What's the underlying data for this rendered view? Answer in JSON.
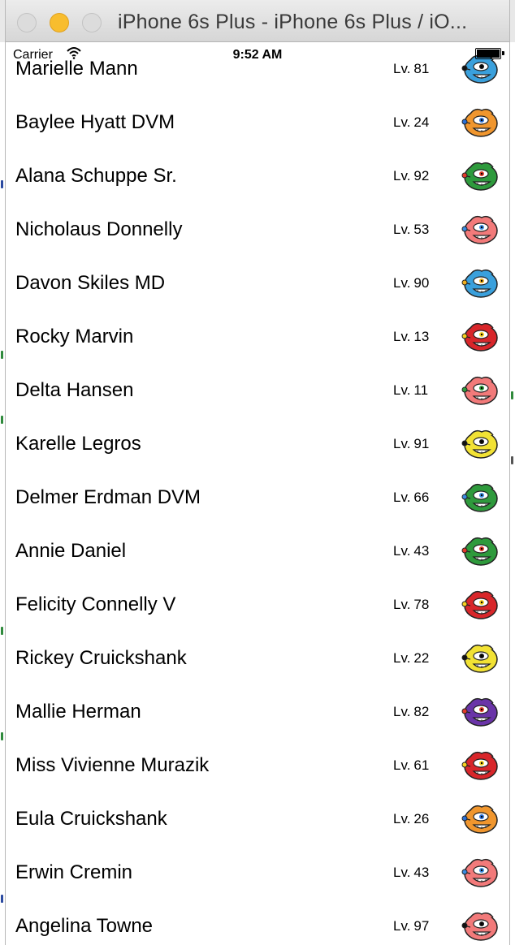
{
  "window": {
    "title": "iPhone 6s Plus - iPhone 6s Plus / iO..."
  },
  "status_bar": {
    "carrier": "Carrier",
    "time": "9:52 AM"
  },
  "level_prefix": "Lv.",
  "players": [
    {
      "name": "Marielle Mann",
      "level": "81",
      "avatar_color": "#3aa0dc",
      "eye_color": "#111111"
    },
    {
      "name": "Baylee Hyatt DVM",
      "level": "24",
      "avatar_color": "#f0962e",
      "eye_color": "#2a6fd6"
    },
    {
      "name": "Alana Schuppe Sr.",
      "level": "92",
      "avatar_color": "#2e9a3c",
      "eye_color": "#e23a2a"
    },
    {
      "name": "Nicholaus Donnelly",
      "level": "53",
      "avatar_color": "#f27a7a",
      "eye_color": "#3a8be0"
    },
    {
      "name": "Davon Skiles MD",
      "level": "90",
      "avatar_color": "#3aa0dc",
      "eye_color": "#f0b020"
    },
    {
      "name": "Rocky Marvin",
      "level": "13",
      "avatar_color": "#d8262a",
      "eye_color": "#f5d020"
    },
    {
      "name": "Delta Hansen",
      "level": "11",
      "avatar_color": "#f27a7a",
      "eye_color": "#2e9a3c"
    },
    {
      "name": "Karelle Legros",
      "level": "91",
      "avatar_color": "#f2e234",
      "eye_color": "#111111"
    },
    {
      "name": "Delmer Erdman DVM",
      "level": "66",
      "avatar_color": "#2e9a3c",
      "eye_color": "#3a8be0"
    },
    {
      "name": "Annie Daniel",
      "level": "43",
      "avatar_color": "#2e9a3c",
      "eye_color": "#e23a2a"
    },
    {
      "name": "Felicity Connelly V",
      "level": "78",
      "avatar_color": "#d8262a",
      "eye_color": "#f5d020"
    },
    {
      "name": "Rickey Cruickshank",
      "level": "22",
      "avatar_color": "#f2e234",
      "eye_color": "#111111"
    },
    {
      "name": "Mallie Herman",
      "level": "82",
      "avatar_color": "#6a34a8",
      "eye_color": "#e23a2a"
    },
    {
      "name": "Miss Vivienne Murazik",
      "level": "61",
      "avatar_color": "#d8262a",
      "eye_color": "#f5d020"
    },
    {
      "name": "Eula Cruickshank",
      "level": "26",
      "avatar_color": "#f0962e",
      "eye_color": "#2a6fd6"
    },
    {
      "name": "Erwin Cremin",
      "level": "43",
      "avatar_color": "#f27a7a",
      "eye_color": "#3a8be0"
    },
    {
      "name": "Angelina Towne",
      "level": "97",
      "avatar_color": "#f27a7a",
      "eye_color": "#111111"
    }
  ]
}
